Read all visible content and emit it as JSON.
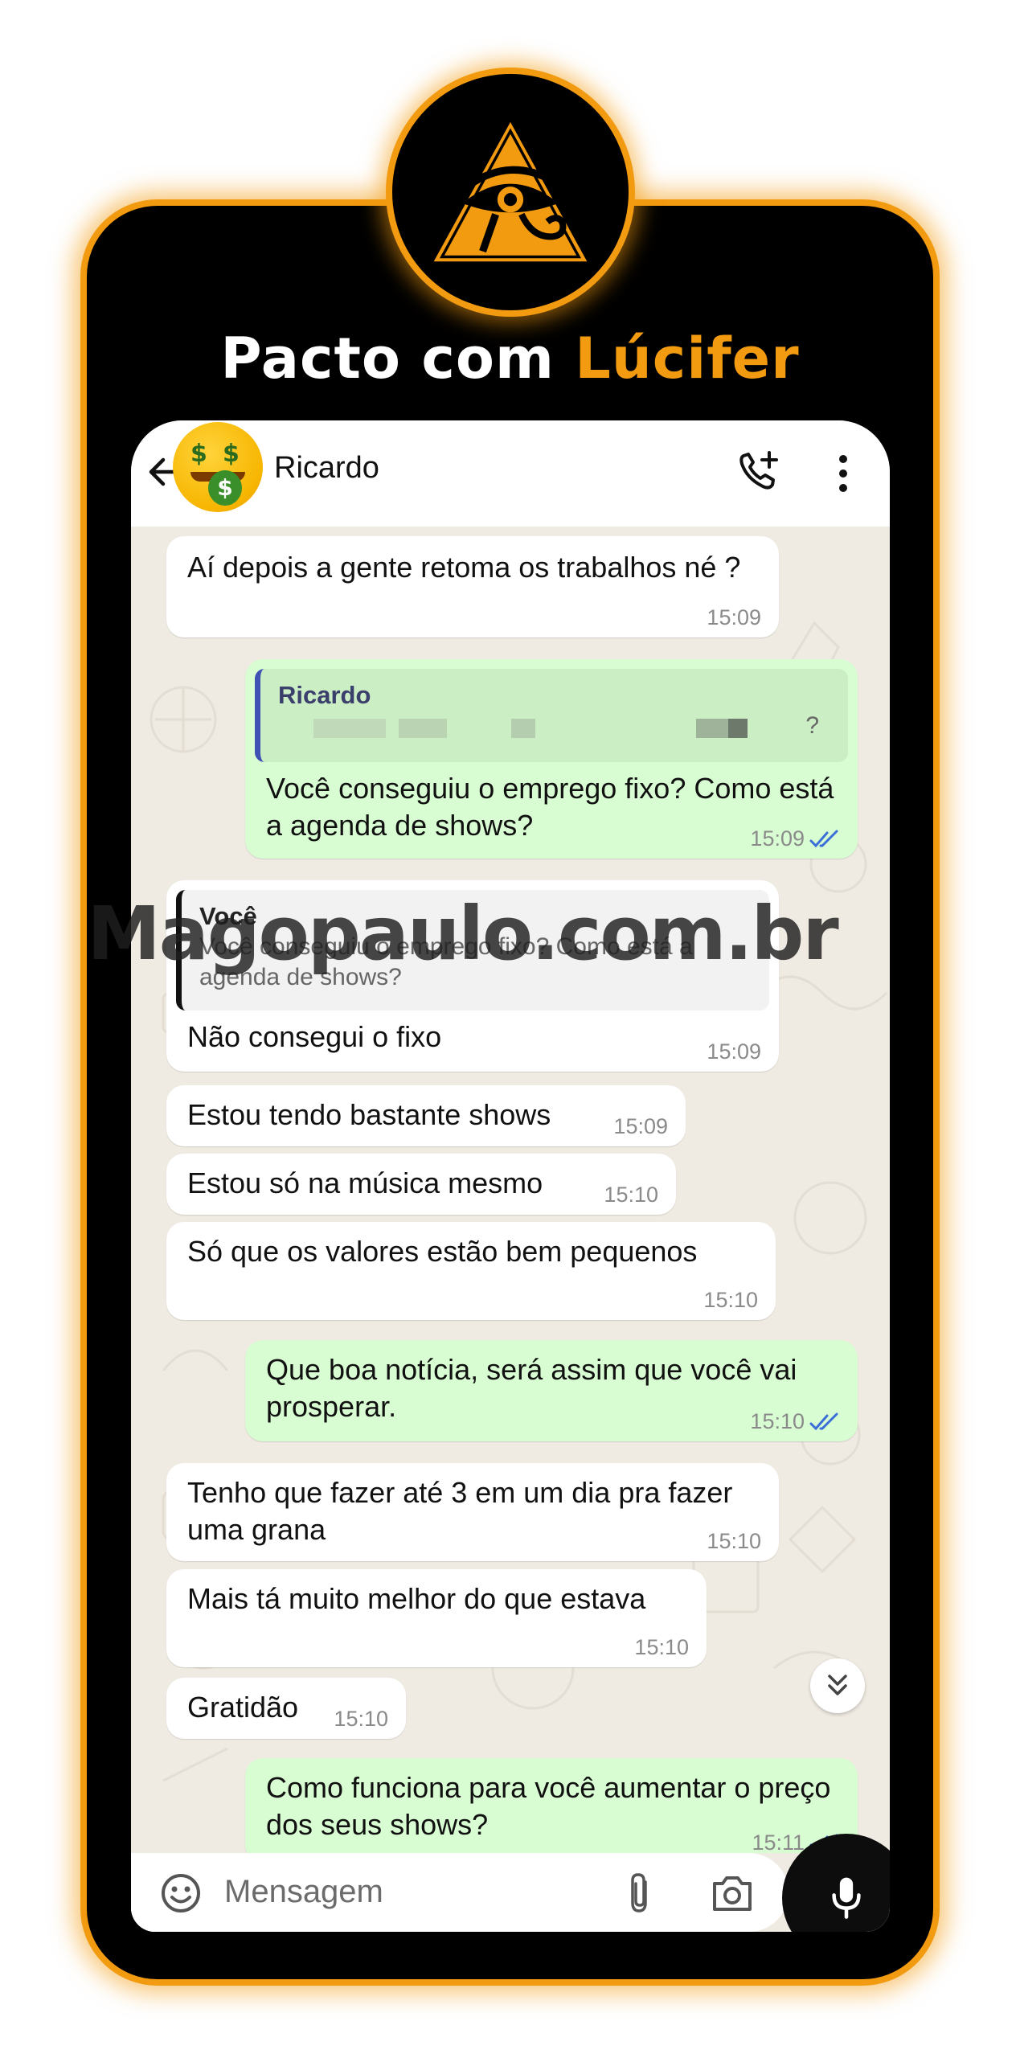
{
  "headline": {
    "prefix": "Pacto com ",
    "accent": "Lúcifer"
  },
  "colors": {
    "accent": "#f29a10",
    "frame": "#000000",
    "out_bubble": "#d9fdd3",
    "in_bubble": "#ffffff",
    "chat_bg": "#efeae2",
    "read_tick": "#3b6fd8"
  },
  "header": {
    "contact_name": "Ricardo",
    "avatar_icon": "money-mouth-face-emoji",
    "back_icon": "arrow-left-icon",
    "call_icon": "add-call-icon",
    "menu_icon": "more-vert-icon"
  },
  "messages": [
    {
      "dir": "in",
      "text": "Aí depois a gente retoma os trabalhos né ?",
      "time": "15:09"
    },
    {
      "dir": "out",
      "quote_name": "Ricardo",
      "quote_text": "?",
      "text": "Você conseguiu o emprego  fixo? Como está a agenda de shows?",
      "time": "15:09",
      "read": true
    },
    {
      "dir": "in",
      "quote_name": "Você",
      "quote_text": "Você conseguiu o emprego  fixo? Como está a agenda de shows?",
      "text": "Não consegui o fixo",
      "time": "15:09"
    },
    {
      "dir": "in",
      "text": "Estou tendo bastante shows",
      "time": "15:09"
    },
    {
      "dir": "in",
      "text": "Estou só na música mesmo",
      "time": "15:10"
    },
    {
      "dir": "in",
      "text": "Só que os valores estão bem pequenos",
      "time": "15:10"
    },
    {
      "dir": "out",
      "text": "Que boa notícia, será assim que você vai prosperar.",
      "time": "15:10",
      "read": true
    },
    {
      "dir": "in",
      "text": "Tenho que fazer até 3 em um dia pra fazer uma grana",
      "time": "15:10"
    },
    {
      "dir": "in",
      "text": "Mais tá muito melhor do que estava",
      "time": "15:10"
    },
    {
      "dir": "in",
      "text": "Gratidão",
      "time": "15:10"
    },
    {
      "dir": "out",
      "text": "Como funciona para você aumentar o preço dos seus shows?",
      "time": "15:11",
      "read": true
    }
  ],
  "watermark": "Magopaulo.com.br",
  "composer": {
    "placeholder": "Mensagem",
    "emoji_icon": "emoji-icon",
    "attach_icon": "paperclip-icon",
    "camera_icon": "camera-icon",
    "mic_icon": "microphone-icon"
  },
  "scroll_icon": "double-chevron-down-icon"
}
